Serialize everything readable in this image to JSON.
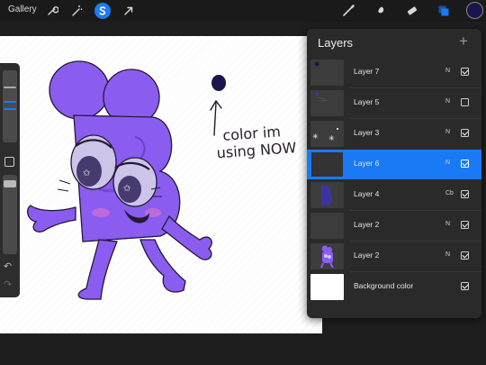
{
  "toolbar": {
    "gallery_label": "Gallery",
    "icons": [
      "wrench-icon",
      "magic-wand-icon",
      "selection-s-icon",
      "transform-arrow-icon",
      "brush-icon",
      "smudge-icon",
      "eraser-icon",
      "layers-icon"
    ],
    "active_tool": "selection-s-icon",
    "current_color": "#18164a",
    "accent_color": "#1a7af6"
  },
  "canvas": {
    "annotation_lines": [
      "color im",
      "using NOW"
    ]
  },
  "layers_panel": {
    "title": "Layers",
    "add_icon": "+",
    "layers": [
      {
        "name": "Layer 7",
        "blend": "N",
        "visible": true,
        "selected": false
      },
      {
        "name": "Layer 5",
        "blend": "N",
        "visible": false,
        "selected": false
      },
      {
        "name": "Layer 3",
        "blend": "N",
        "visible": true,
        "selected": false
      },
      {
        "name": "Layer 6",
        "blend": "N",
        "visible": true,
        "selected": true
      },
      {
        "name": "Layer 4",
        "blend": "Cb",
        "visible": true,
        "selected": false
      },
      {
        "name": "Layer 2",
        "blend": "N",
        "visible": true,
        "selected": false
      },
      {
        "name": "Layer 2",
        "blend": "N",
        "visible": true,
        "selected": false
      },
      {
        "name": "Background color",
        "blend": "",
        "visible": true,
        "selected": false
      }
    ]
  }
}
